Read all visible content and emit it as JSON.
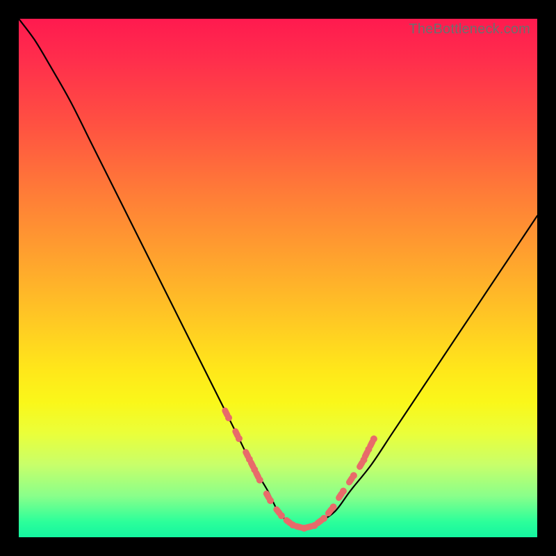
{
  "watermark": "TheBottleneck.com",
  "chart_data": {
    "type": "line",
    "title": "",
    "xlabel": "",
    "ylabel": "",
    "xlim": [
      0,
      100
    ],
    "ylim": [
      0,
      100
    ],
    "series": [
      {
        "name": "bottleneck-curve",
        "x": [
          0,
          3,
          6,
          10,
          14,
          18,
          22,
          26,
          30,
          34,
          38,
          42,
          45,
          48,
          50,
          52,
          54,
          56,
          58,
          61,
          64,
          68,
          72,
          76,
          80,
          84,
          88,
          92,
          96,
          100
        ],
        "y": [
          100,
          96,
          91,
          84,
          76,
          68,
          60,
          52,
          44,
          36,
          28,
          20,
          14,
          9,
          5,
          3,
          2,
          2,
          3,
          5,
          9,
          14,
          20,
          26,
          32,
          38,
          44,
          50,
          56,
          62
        ]
      }
    ],
    "markers": {
      "name": "highlighted-points",
      "color": "#e86a6a",
      "points": [
        {
          "x": 40,
          "y": 24
        },
        {
          "x": 42,
          "y": 20
        },
        {
          "x": 44,
          "y": 16
        },
        {
          "x": 45,
          "y": 14
        },
        {
          "x": 46,
          "y": 12
        },
        {
          "x": 48,
          "y": 8
        },
        {
          "x": 50,
          "y": 5
        },
        {
          "x": 52,
          "y": 3
        },
        {
          "x": 54,
          "y": 2
        },
        {
          "x": 56,
          "y": 2
        },
        {
          "x": 58,
          "y": 3
        },
        {
          "x": 60,
          "y": 5
        },
        {
          "x": 62,
          "y": 8
        },
        {
          "x": 64,
          "y": 11
        },
        {
          "x": 66,
          "y": 14
        },
        {
          "x": 67,
          "y": 16
        },
        {
          "x": 68,
          "y": 18
        }
      ]
    }
  }
}
